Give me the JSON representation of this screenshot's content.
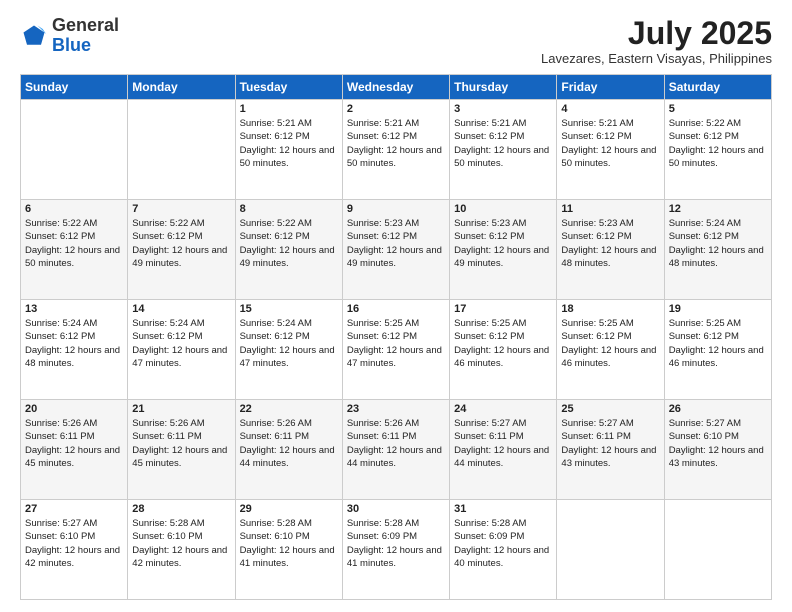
{
  "logo": {
    "general": "General",
    "blue": "Blue"
  },
  "title": "July 2025",
  "location": "Lavezares, Eastern Visayas, Philippines",
  "weekdays": [
    "Sunday",
    "Monday",
    "Tuesday",
    "Wednesday",
    "Thursday",
    "Friday",
    "Saturday"
  ],
  "weeks": [
    [
      {
        "day": "",
        "sunrise": "",
        "sunset": "",
        "daylight": ""
      },
      {
        "day": "",
        "sunrise": "",
        "sunset": "",
        "daylight": ""
      },
      {
        "day": "1",
        "sunrise": "Sunrise: 5:21 AM",
        "sunset": "Sunset: 6:12 PM",
        "daylight": "Daylight: 12 hours and 50 minutes."
      },
      {
        "day": "2",
        "sunrise": "Sunrise: 5:21 AM",
        "sunset": "Sunset: 6:12 PM",
        "daylight": "Daylight: 12 hours and 50 minutes."
      },
      {
        "day": "3",
        "sunrise": "Sunrise: 5:21 AM",
        "sunset": "Sunset: 6:12 PM",
        "daylight": "Daylight: 12 hours and 50 minutes."
      },
      {
        "day": "4",
        "sunrise": "Sunrise: 5:21 AM",
        "sunset": "Sunset: 6:12 PM",
        "daylight": "Daylight: 12 hours and 50 minutes."
      },
      {
        "day": "5",
        "sunrise": "Sunrise: 5:22 AM",
        "sunset": "Sunset: 6:12 PM",
        "daylight": "Daylight: 12 hours and 50 minutes."
      }
    ],
    [
      {
        "day": "6",
        "sunrise": "Sunrise: 5:22 AM",
        "sunset": "Sunset: 6:12 PM",
        "daylight": "Daylight: 12 hours and 50 minutes."
      },
      {
        "day": "7",
        "sunrise": "Sunrise: 5:22 AM",
        "sunset": "Sunset: 6:12 PM",
        "daylight": "Daylight: 12 hours and 49 minutes."
      },
      {
        "day": "8",
        "sunrise": "Sunrise: 5:22 AM",
        "sunset": "Sunset: 6:12 PM",
        "daylight": "Daylight: 12 hours and 49 minutes."
      },
      {
        "day": "9",
        "sunrise": "Sunrise: 5:23 AM",
        "sunset": "Sunset: 6:12 PM",
        "daylight": "Daylight: 12 hours and 49 minutes."
      },
      {
        "day": "10",
        "sunrise": "Sunrise: 5:23 AM",
        "sunset": "Sunset: 6:12 PM",
        "daylight": "Daylight: 12 hours and 49 minutes."
      },
      {
        "day": "11",
        "sunrise": "Sunrise: 5:23 AM",
        "sunset": "Sunset: 6:12 PM",
        "daylight": "Daylight: 12 hours and 48 minutes."
      },
      {
        "day": "12",
        "sunrise": "Sunrise: 5:24 AM",
        "sunset": "Sunset: 6:12 PM",
        "daylight": "Daylight: 12 hours and 48 minutes."
      }
    ],
    [
      {
        "day": "13",
        "sunrise": "Sunrise: 5:24 AM",
        "sunset": "Sunset: 6:12 PM",
        "daylight": "Daylight: 12 hours and 48 minutes."
      },
      {
        "day": "14",
        "sunrise": "Sunrise: 5:24 AM",
        "sunset": "Sunset: 6:12 PM",
        "daylight": "Daylight: 12 hours and 47 minutes."
      },
      {
        "day": "15",
        "sunrise": "Sunrise: 5:24 AM",
        "sunset": "Sunset: 6:12 PM",
        "daylight": "Daylight: 12 hours and 47 minutes."
      },
      {
        "day": "16",
        "sunrise": "Sunrise: 5:25 AM",
        "sunset": "Sunset: 6:12 PM",
        "daylight": "Daylight: 12 hours and 47 minutes."
      },
      {
        "day": "17",
        "sunrise": "Sunrise: 5:25 AM",
        "sunset": "Sunset: 6:12 PM",
        "daylight": "Daylight: 12 hours and 46 minutes."
      },
      {
        "day": "18",
        "sunrise": "Sunrise: 5:25 AM",
        "sunset": "Sunset: 6:12 PM",
        "daylight": "Daylight: 12 hours and 46 minutes."
      },
      {
        "day": "19",
        "sunrise": "Sunrise: 5:25 AM",
        "sunset": "Sunset: 6:12 PM",
        "daylight": "Daylight: 12 hours and 46 minutes."
      }
    ],
    [
      {
        "day": "20",
        "sunrise": "Sunrise: 5:26 AM",
        "sunset": "Sunset: 6:11 PM",
        "daylight": "Daylight: 12 hours and 45 minutes."
      },
      {
        "day": "21",
        "sunrise": "Sunrise: 5:26 AM",
        "sunset": "Sunset: 6:11 PM",
        "daylight": "Daylight: 12 hours and 45 minutes."
      },
      {
        "day": "22",
        "sunrise": "Sunrise: 5:26 AM",
        "sunset": "Sunset: 6:11 PM",
        "daylight": "Daylight: 12 hours and 44 minutes."
      },
      {
        "day": "23",
        "sunrise": "Sunrise: 5:26 AM",
        "sunset": "Sunset: 6:11 PM",
        "daylight": "Daylight: 12 hours and 44 minutes."
      },
      {
        "day": "24",
        "sunrise": "Sunrise: 5:27 AM",
        "sunset": "Sunset: 6:11 PM",
        "daylight": "Daylight: 12 hours and 44 minutes."
      },
      {
        "day": "25",
        "sunrise": "Sunrise: 5:27 AM",
        "sunset": "Sunset: 6:11 PM",
        "daylight": "Daylight: 12 hours and 43 minutes."
      },
      {
        "day": "26",
        "sunrise": "Sunrise: 5:27 AM",
        "sunset": "Sunset: 6:10 PM",
        "daylight": "Daylight: 12 hours and 43 minutes."
      }
    ],
    [
      {
        "day": "27",
        "sunrise": "Sunrise: 5:27 AM",
        "sunset": "Sunset: 6:10 PM",
        "daylight": "Daylight: 12 hours and 42 minutes."
      },
      {
        "day": "28",
        "sunrise": "Sunrise: 5:28 AM",
        "sunset": "Sunset: 6:10 PM",
        "daylight": "Daylight: 12 hours and 42 minutes."
      },
      {
        "day": "29",
        "sunrise": "Sunrise: 5:28 AM",
        "sunset": "Sunset: 6:10 PM",
        "daylight": "Daylight: 12 hours and 41 minutes."
      },
      {
        "day": "30",
        "sunrise": "Sunrise: 5:28 AM",
        "sunset": "Sunset: 6:09 PM",
        "daylight": "Daylight: 12 hours and 41 minutes."
      },
      {
        "day": "31",
        "sunrise": "Sunrise: 5:28 AM",
        "sunset": "Sunset: 6:09 PM",
        "daylight": "Daylight: 12 hours and 40 minutes."
      },
      {
        "day": "",
        "sunrise": "",
        "sunset": "",
        "daylight": ""
      },
      {
        "day": "",
        "sunrise": "",
        "sunset": "",
        "daylight": ""
      }
    ]
  ]
}
